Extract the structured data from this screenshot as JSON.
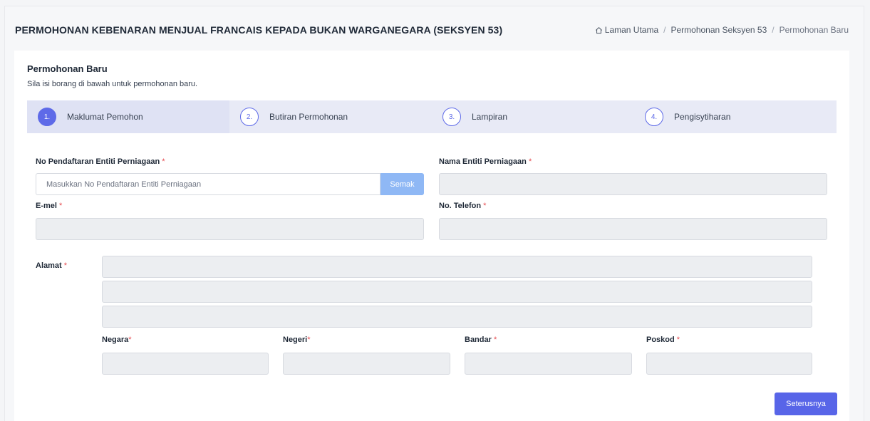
{
  "page": {
    "title": "PERMOHONAN KEBENARAN MENJUAL FRANCAIS KEPADA BUKAN WARGANEGARA (SEKSYEN 53)"
  },
  "breadcrumb": {
    "home": "Laman Utama",
    "section": "Permohonan Seksyen 53",
    "current": "Permohonan Baru"
  },
  "card": {
    "title": "Permohonan Baru",
    "subtitle": "Sila isi borang di bawah untuk permohonan baru."
  },
  "steps": [
    {
      "num": "1.",
      "label": "Maklumat Pemohon"
    },
    {
      "num": "2.",
      "label": "Butiran Permohonan"
    },
    {
      "num": "3.",
      "label": "Lampiran"
    },
    {
      "num": "4.",
      "label": "Pengisytiharan"
    }
  ],
  "form": {
    "reg_no_label": "No Pendaftaran Entiti Perniagaan",
    "reg_no_placeholder": "Masukkan No Pendaftaran Entiti Perniagaan",
    "check_button": "Semak",
    "entity_name_label": "Nama Entiti Perniagaan",
    "email_label": "E-mel",
    "phone_label": "No. Telefon",
    "address_label": "Alamat",
    "country_label": "Negara",
    "state_label": "Negeri",
    "city_label": "Bandar",
    "postcode_label": "Poskod",
    "required_mark": "*"
  },
  "actions": {
    "next": "Seterusnya"
  },
  "colors": {
    "primary": "#5865e8",
    "step_bg": "#e8eaf6",
    "required": "#e5484d",
    "check_button": "#8fb8f5"
  }
}
